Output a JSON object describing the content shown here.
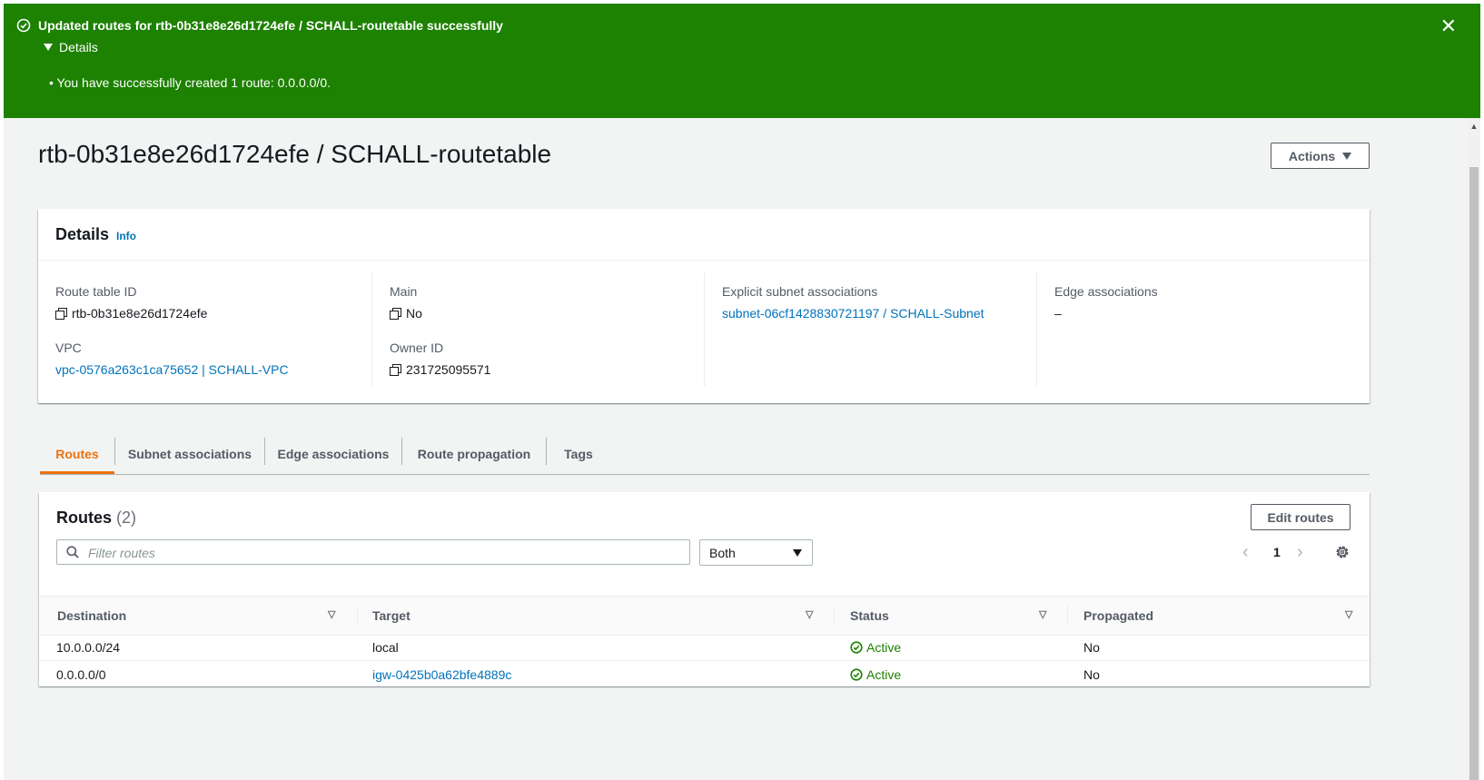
{
  "flash": {
    "title": "Updated routes for rtb-0b31e8e26d1724efe / SCHALL-routetable successfully",
    "details_label": "Details",
    "message": "You have successfully created 1 route: 0.0.0.0/0.",
    "close_icon": "close-icon",
    "color": "#1d8102"
  },
  "header": {
    "title": "rtb-0b31e8e26d1724efe / SCHALL-routetable",
    "actions_label": "Actions"
  },
  "details": {
    "title": "Details",
    "info_label": "Info",
    "fields": {
      "route_table_id": {
        "label": "Route table ID",
        "value": "rtb-0b31e8e26d1724efe"
      },
      "vpc": {
        "label": "VPC",
        "value": "vpc-0576a263c1ca75652 | SCHALL-VPC"
      },
      "main": {
        "label": "Main",
        "value": "No"
      },
      "owner_id": {
        "label": "Owner ID",
        "value": "231725095571"
      },
      "explicit_subnet": {
        "label": "Explicit subnet associations",
        "value": "subnet-06cf1428830721197 / SCHALL-Subnet"
      },
      "edge": {
        "label": "Edge associations",
        "value": "–"
      }
    }
  },
  "tabs": [
    {
      "label": "Routes",
      "active": true
    },
    {
      "label": "Subnet associations",
      "active": false
    },
    {
      "label": "Edge associations",
      "active": false
    },
    {
      "label": "Route propagation",
      "active": false
    },
    {
      "label": "Tags",
      "active": false
    }
  ],
  "routes": {
    "title": "Routes",
    "count": "(2)",
    "edit_label": "Edit routes",
    "filter_placeholder": "Filter routes",
    "select_value": "Both",
    "page": "1",
    "columns": [
      "Destination",
      "Target",
      "Status",
      "Propagated"
    ],
    "rows": [
      {
        "destination": "10.0.0.0/24",
        "target": "local",
        "target_link": false,
        "status": "Active",
        "propagated": "No"
      },
      {
        "destination": "0.0.0.0/0",
        "target": "igw-0425b0a62bfe4889c",
        "target_link": true,
        "status": "Active",
        "propagated": "No"
      }
    ]
  },
  "colors": {
    "link": "#0073bb",
    "active_tab": "#ec7211",
    "status_active": "#1d8102"
  }
}
